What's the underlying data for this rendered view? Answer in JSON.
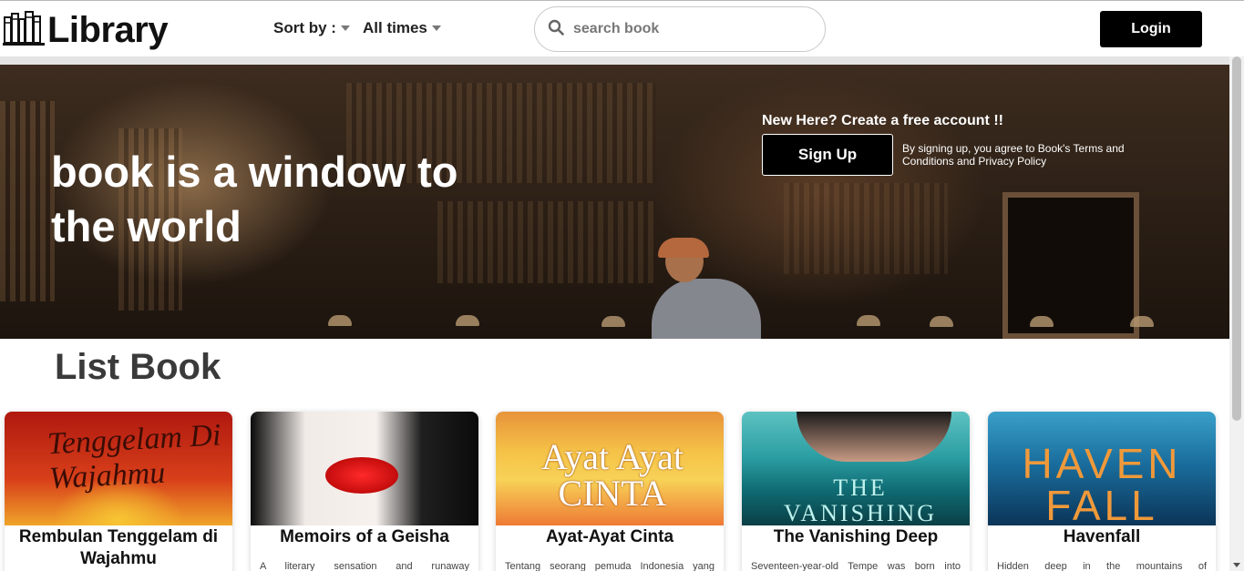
{
  "navbar": {
    "logo_text": "Library",
    "sort_label": "Sort by :",
    "time_label": "All times",
    "search_placeholder": "search book",
    "login_label": "Login"
  },
  "hero": {
    "title": "book is a window to the world",
    "new_here": "New Here? Create a free account !!",
    "signup_label": "Sign Up",
    "terms": "By signing up, you agree to Book's Terms and Conditions and Privacy Policy"
  },
  "section": {
    "title": "List Book"
  },
  "books": [
    {
      "title": "Rembulan Tenggelam di Wajahmu",
      "desc": "",
      "cover_text": "Tenggelam Di Wajahmu",
      "colors": [
        "#b91c12",
        "#f3a321"
      ]
    },
    {
      "title": "Memoirs of a Geisha",
      "desc": "A literary sensation and runaway",
      "cover_text": "",
      "colors": [
        "#f4eeea",
        "#1a1a1a"
      ]
    },
    {
      "title": "Ayat-Ayat Cinta",
      "desc": "Tentang seorang pemuda Indonesia yang",
      "cover_text": "Ayat Ayat CINTA",
      "colors": [
        "#f6d24a",
        "#e0542b"
      ]
    },
    {
      "title": "The Vanishing Deep",
      "desc": "Seventeen-year-old Tempe was born into",
      "cover_text": "THE VANISHING",
      "colors": [
        "#2aa3a6",
        "#0d3b3f"
      ]
    },
    {
      "title": "Havenfall",
      "desc": "Hidden deep in the mountains of",
      "cover_text": "HAVEN FALL",
      "colors": [
        "#1a74a4",
        "#0b2a44"
      ]
    }
  ],
  "colors": {
    "primary": "#000000",
    "text_dark": "#111111",
    "section_title": "#3a3a3a"
  }
}
